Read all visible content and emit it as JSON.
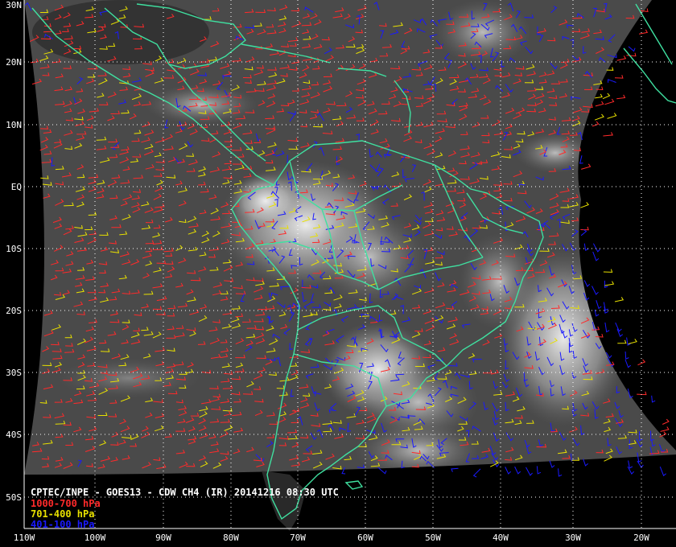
{
  "header": {
    "product": "CPTEC/INPE - GOES13 - CDW CH4 (IR) 20141216 08:30 UTC"
  },
  "legend": [
    {
      "label": "1000-700 hPa",
      "color": "#ff2a2a"
    },
    {
      "label": "701-400 hPa",
      "color": "#e8e000"
    },
    {
      "label": "401-100 hPa",
      "color": "#1a1aff"
    }
  ],
  "colors": {
    "coast": "#3fe0a0",
    "grid": "#ffffff",
    "background": "#000000",
    "cloud_dark": "#3b3b3b",
    "cloud_bright": "#e8e8e8"
  },
  "lat_labels": [
    "30N",
    "20N",
    "10N",
    "EQ",
    "10S",
    "20S",
    "30S",
    "40S",
    "50S"
  ],
  "lon_labels": [
    "110W",
    "100W",
    "90W",
    "80W",
    "70W",
    "60W",
    "50W",
    "40W",
    "30W",
    "20W"
  ],
  "icons": {
    "map": "satellite-map-icon"
  }
}
